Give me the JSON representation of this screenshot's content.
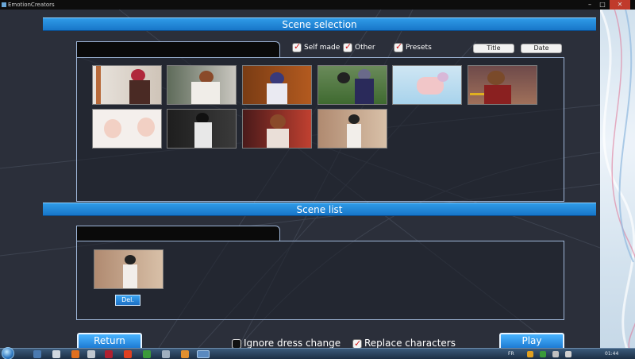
{
  "window": {
    "title": "EmotionCreators"
  },
  "scene_selection": {
    "header": "Scene selection",
    "filters": [
      {
        "label": "Self made",
        "checked": true
      },
      {
        "label": "Other",
        "checked": true
      },
      {
        "label": "Presets",
        "checked": true
      }
    ],
    "sort_buttons": [
      "Title",
      "Date"
    ]
  },
  "scene_list": {
    "header": "Scene list",
    "delete_label": "Del."
  },
  "footer": {
    "return_label": "Return",
    "play_label": "Play",
    "ignore_dress_label": "Ignore dress change",
    "ignore_dress_checked": false,
    "replace_chars_label": "Replace characters",
    "replace_chars_checked": true
  },
  "taskbar": {
    "language": "FR",
    "time": "01:44"
  },
  "colors": {
    "header_blue": "#1e86d8",
    "game_bg": "#2b2f3a",
    "checkmark_red": "#d21a1a"
  }
}
